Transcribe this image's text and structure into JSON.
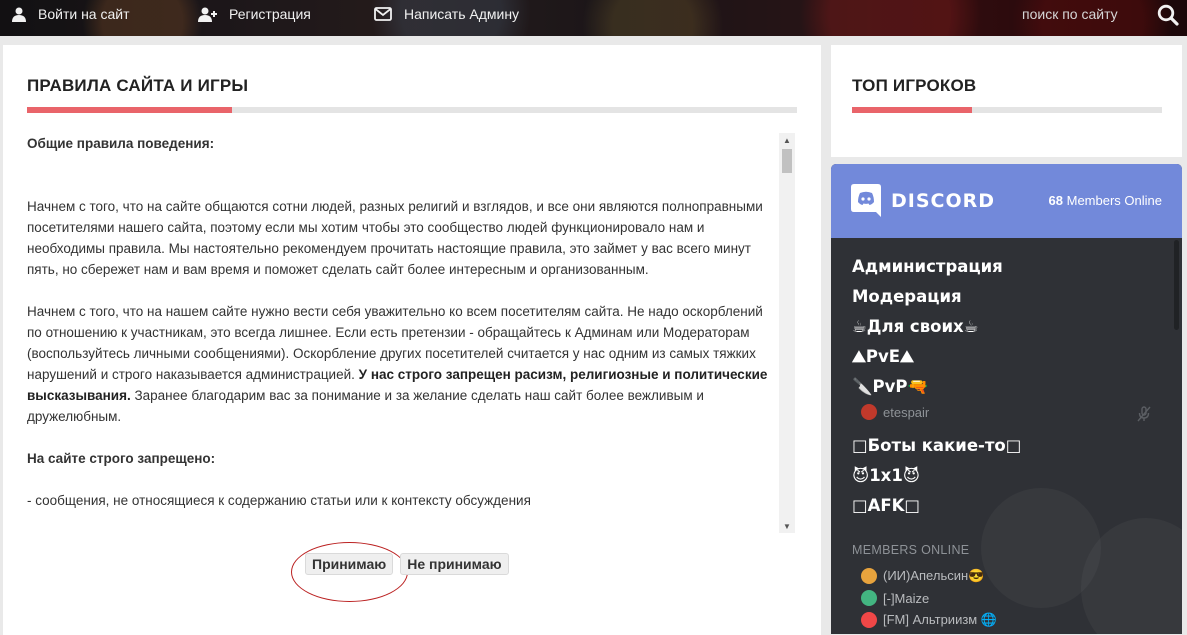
{
  "topnav": {
    "login_label": "Войти на сайт",
    "register_label": "Регистрация",
    "write_admin_label": "Написать Админу",
    "search_placeholder": "поиск по сайту"
  },
  "main": {
    "title": "ПРАВИЛА САЙТА И ИГРЫ",
    "rules": {
      "heading": "Общие правила поведения:",
      "p1": "Начнем с того, что на сайте общаются сотни людей, разных религий и взглядов, и все они являются полноправными посетителями нашего сайта, поэтому если мы хотим чтобы это сообщество людей функционировало нам и необходимы правила. Мы настоятельно рекомендуем прочитать настоящие правила, это займет у вас всего минут пять, но сбережет нам и вам время и поможет сделать сайт более интересным и организованным.",
      "p2_start": "Начнем с того, что на нашем сайте нужно вести себя уважительно ко всем посетителям сайта. Не надо оскорблений по отношению к участникам, это всегда лишнее. Если есть претензии - обращайтесь к Админам или Модераторам (воспользуйтесь личными сообщениями). Оскорбление других посетителей считается у нас одним из самых тяжких нарушений и строго наказывается администрацией.",
      "p2_bold": "У нас строго запрещен расизм, религиозные и политические высказывания.",
      "p2_end": "Заранее благодарим вас за понимание и за желание сделать наш сайт более вежливым и дружелюбным.",
      "heading2": "На сайте строго запрещено:",
      "p3": "- сообщения, не относящиеся к содержанию статьи или к контексту обсуждения"
    },
    "accept_label": "Принимаю",
    "decline_label": "Не принимаю"
  },
  "sidebar": {
    "top_players_title": "ТОП ИГРОКОВ",
    "discord": {
      "brand": "DISCORD",
      "members_online_count": "68",
      "members_online_label": "Members Online",
      "channels": [
        "Администрация",
        "Модерация",
        "☕Для своих☕",
        "⛰PvE⛰",
        "🔪PvP🔫",
        "etespair",
        "□Боты какие-то□",
        "😈1x1😈",
        "□AFK□"
      ],
      "members_online_heading": "MEMBERS ONLINE",
      "members": [
        "(ИИ)Апельсин😎",
        "[-]Maize",
        "[FM] Альтриизм 🌐"
      ],
      "colors": {
        "header": "#7289da",
        "body": "#2f3136"
      }
    }
  },
  "colors": {
    "accent": "#e9646a"
  }
}
